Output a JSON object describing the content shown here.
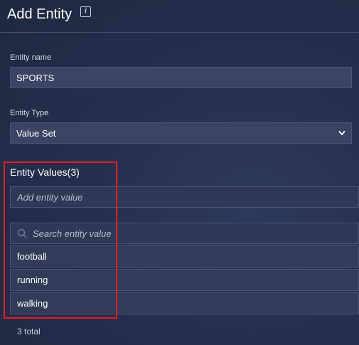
{
  "header": {
    "title": "Add Entity",
    "info_icon": "info-icon"
  },
  "entity_name": {
    "label": "Entity name",
    "value": "SPORTS"
  },
  "entity_type": {
    "label": "Entity Type",
    "selected": "Value Set",
    "icon": "chevron-down-icon"
  },
  "entity_values": {
    "title": "Entity Values(3)",
    "add_placeholder": "Add entity value",
    "search_placeholder": "Search entity value",
    "items": [
      "football",
      "running",
      "walking"
    ],
    "total_text": "3 total"
  },
  "colors": {
    "background": "#26304d",
    "field": "#3b4462",
    "highlight": "#e01f28"
  }
}
